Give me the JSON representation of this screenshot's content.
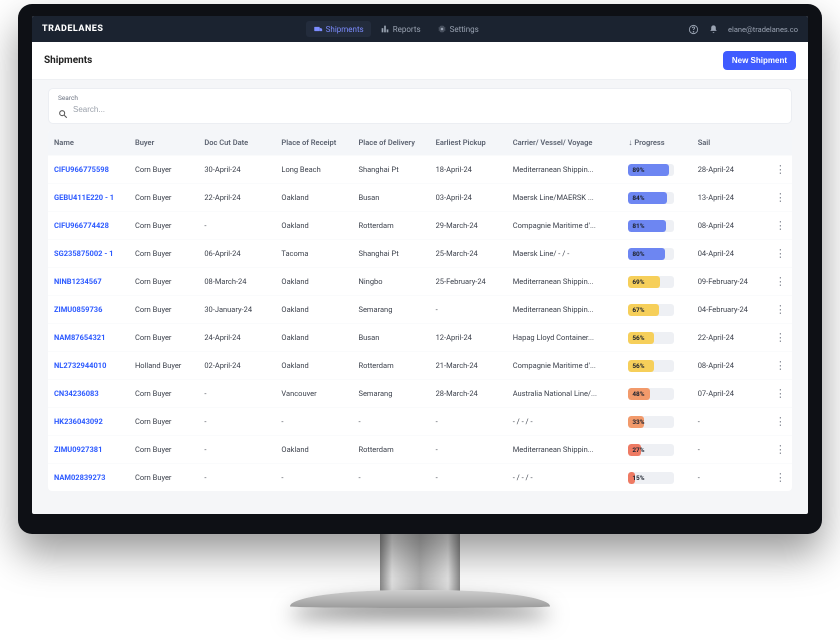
{
  "brand": "TRADELANES",
  "nav": {
    "shipments": "Shipments",
    "reports": "Reports",
    "settings": "Settings"
  },
  "user_email": "elane@tradelanes.co",
  "page_title": "Shipments",
  "new_shipment_label": "New Shipment",
  "search": {
    "label": "Search",
    "placeholder": "Search..."
  },
  "columns": {
    "name": "Name",
    "buyer": "Buyer",
    "doc_cut": "Doc Cut Date",
    "receipt": "Place of Receipt",
    "delivery": "Place of Delivery",
    "pickup": "Earliest Pickup",
    "carrier": "Carrier/ Vessel/ Voyage",
    "progress": "Progress",
    "sail": "Sail"
  },
  "sort_indicator": "↓",
  "progress_colors": {
    "blue": "#6d86f2",
    "yellow": "#f6cf5a",
    "orange": "#f29a6b",
    "red": "#ee7a63"
  },
  "rows": [
    {
      "name": "CIFU966775598",
      "buyer": "Corn Buyer",
      "doc": "30-April-24",
      "receipt": "Long Beach",
      "delivery": "Shanghai Pt",
      "pickup": "18-April-24",
      "carrier": "Mediterranean Shippin...",
      "progress": 89,
      "pcolor": "blue",
      "sail": "28-April-24"
    },
    {
      "name": "GEBU411E220 - 1",
      "buyer": "Corn Buyer",
      "doc": "22-April-24",
      "receipt": "Oakland",
      "delivery": "Busan",
      "pickup": "03-April-24",
      "carrier": "Maersk Line/MAERSK ...",
      "progress": 84,
      "pcolor": "blue",
      "sail": "13-April-24"
    },
    {
      "name": "CIFU966774428",
      "buyer": "Corn Buyer",
      "doc": "-",
      "receipt": "Oakland",
      "delivery": "Rotterdam",
      "pickup": "29-March-24",
      "carrier": "Compagnie Maritime d'...",
      "progress": 81,
      "pcolor": "blue",
      "sail": "08-April-24"
    },
    {
      "name": "SG235875002 - 1",
      "buyer": "Corn Buyer",
      "doc": "06-April-24",
      "receipt": "Tacoma",
      "delivery": "Shanghai Pt",
      "pickup": "25-March-24",
      "carrier": "Maersk Line/ - / -",
      "progress": 80,
      "pcolor": "blue",
      "sail": "04-April-24"
    },
    {
      "name": "NINB1234567",
      "buyer": "Corn Buyer",
      "doc": "08-March-24",
      "receipt": "Oakland",
      "delivery": "Ningbo",
      "pickup": "25-February-24",
      "carrier": "Mediterranean Shippin...",
      "progress": 69,
      "pcolor": "yellow",
      "sail": "09-February-24"
    },
    {
      "name": "ZIMU0859736",
      "buyer": "Corn Buyer",
      "doc": "30-January-24",
      "receipt": "Oakland",
      "delivery": "Semarang",
      "pickup": "-",
      "carrier": "Mediterranean Shippin...",
      "progress": 67,
      "pcolor": "yellow",
      "sail": "04-February-24"
    },
    {
      "name": "NAM87654321",
      "buyer": "Corn Buyer",
      "doc": "24-April-24",
      "receipt": "Oakland",
      "delivery": "Busan",
      "pickup": "12-April-24",
      "carrier": "Hapag Lloyd Container...",
      "progress": 56,
      "pcolor": "yellow",
      "sail": "22-April-24"
    },
    {
      "name": "NL2732944010",
      "buyer": "Holland Buyer",
      "doc": "02-April-24",
      "receipt": "Oakland",
      "delivery": "Rotterdam",
      "pickup": "21-March-24",
      "carrier": "Compagnie Maritime d'...",
      "progress": 56,
      "pcolor": "yellow",
      "sail": "08-April-24"
    },
    {
      "name": "CN34236083",
      "buyer": "Corn Buyer",
      "doc": "-",
      "receipt": "Vancouver",
      "delivery": "Semarang",
      "pickup": "28-March-24",
      "carrier": "Australia National Line/...",
      "progress": 48,
      "pcolor": "orange",
      "sail": "07-April-24"
    },
    {
      "name": "HK236043092",
      "buyer": "Corn Buyer",
      "doc": "-",
      "receipt": "-",
      "delivery": "-",
      "pickup": "-",
      "carrier": "- / - / -",
      "progress": 33,
      "pcolor": "orange",
      "sail": "-"
    },
    {
      "name": "ZIMU0927381",
      "buyer": "Corn Buyer",
      "doc": "-",
      "receipt": "Oakland",
      "delivery": "Rotterdam",
      "pickup": "-",
      "carrier": "Mediterranean Shippin...",
      "progress": 27,
      "pcolor": "red",
      "sail": "-"
    },
    {
      "name": "NAM02839273",
      "buyer": "Corn Buyer",
      "doc": "-",
      "receipt": "-",
      "delivery": "-",
      "pickup": "-",
      "carrier": "- / - / -",
      "progress": 15,
      "pcolor": "red",
      "sail": "-"
    }
  ]
}
